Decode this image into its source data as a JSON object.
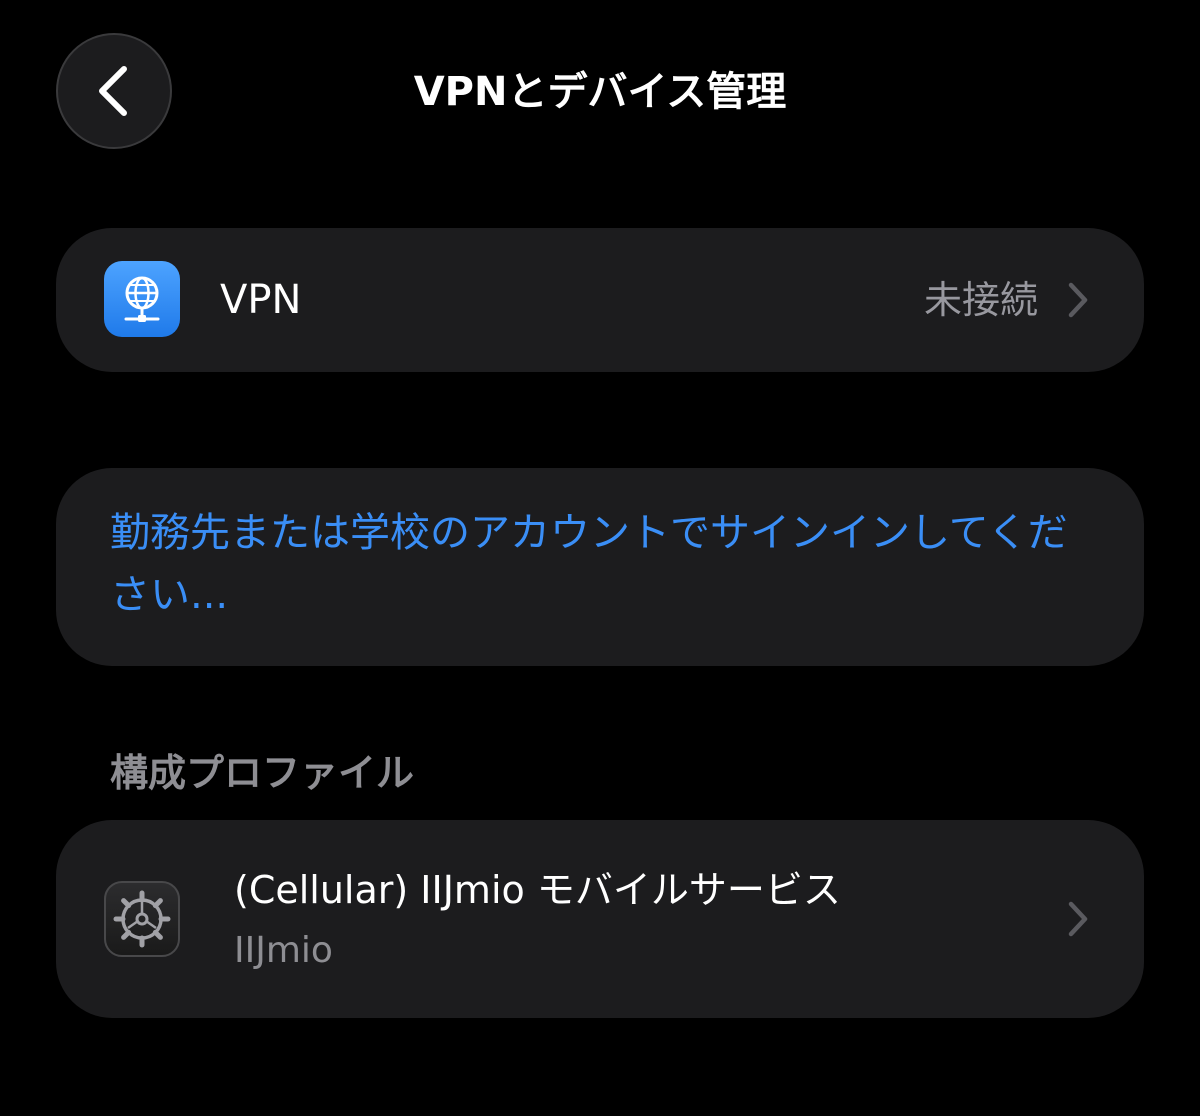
{
  "header": {
    "title": "VPNとデバイス管理",
    "back_icon": "chevron-left-icon"
  },
  "vpn": {
    "label": "VPN",
    "status": "未接続",
    "icon": "globe-network-icon",
    "icon_color": "#2f8cf5"
  },
  "signin": {
    "link": "勤務先または学校のアカウントでサインインしてください..."
  },
  "profiles": {
    "section_title": "構成プロファイル",
    "items": [
      {
        "name": "(Cellular) IIJmio モバイルサービス",
        "organization": "IIJmio",
        "icon": "gear-icon"
      }
    ]
  },
  "colors": {
    "background": "#000000",
    "card": "#1c1c1e",
    "link": "#3a8ef6",
    "secondary_text": "#8e8e93"
  }
}
